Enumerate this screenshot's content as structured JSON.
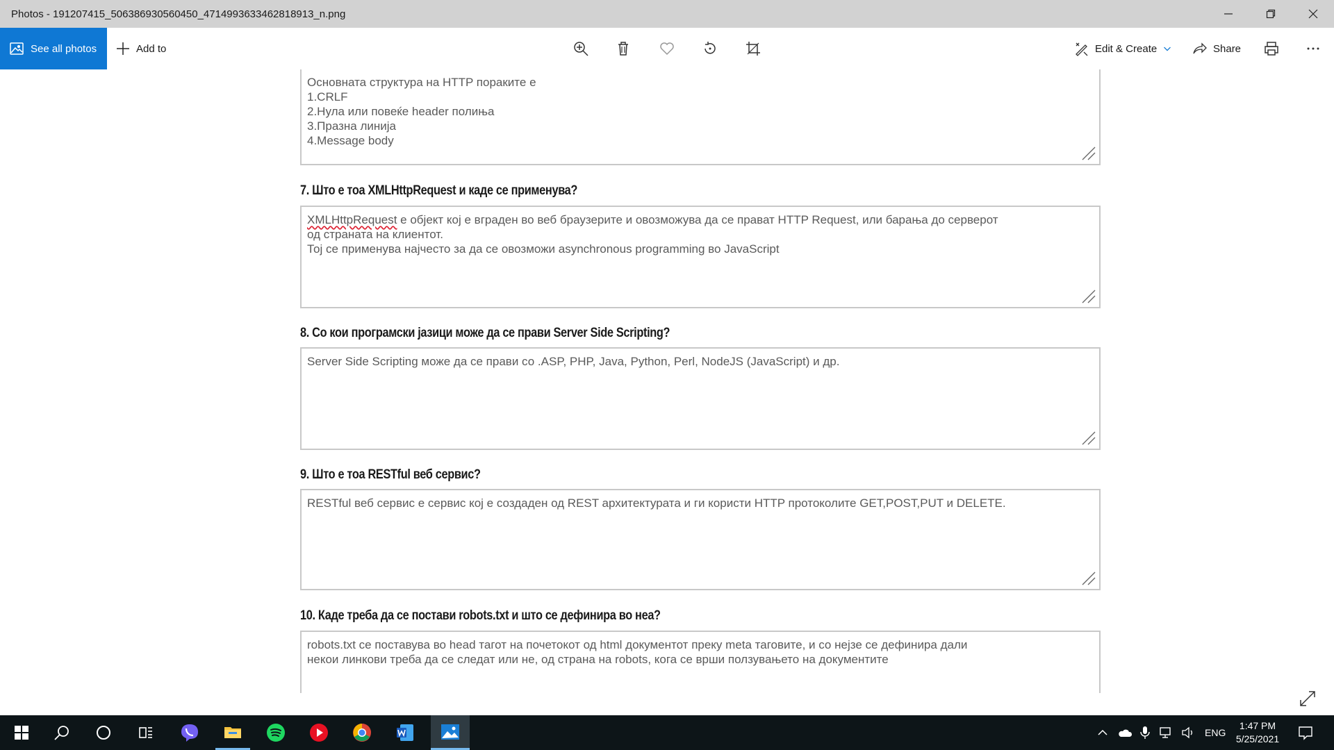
{
  "window": {
    "title": "Photos - 191207415_506386930560450_4714993633462818913_n.png"
  },
  "toolbar": {
    "see_all_label": "See all photos",
    "add_to_label": "Add to",
    "edit_create_label": "Edit & Create",
    "share_label": "Share",
    "icons": [
      "zoom-in-icon",
      "delete-icon",
      "favorite-icon",
      "rotate-icon",
      "crop-icon",
      "print-icon",
      "more-icon"
    ]
  },
  "photo": {
    "box0": {
      "lines": [
        "Основната структура на HTTP пораките е",
        "1.CRLF",
        "2.Нула или повеќе header полиња",
        "3.Празна линија",
        "4.Message body"
      ]
    },
    "q7": {
      "question": "7. Што е тоа XMLHttpRequest и каде се применува?",
      "misspelled": "XMLHttpRequest",
      "line1_rest": " е објект кој е вграден во веб браузерите и овозможува да се прават HTTP Request, или барања до серверот",
      "line2": "од страната на клиентот.",
      "line3": "Тој се применува најчесто за да се овозможи asynchronous programming во JavaScript"
    },
    "q8": {
      "question": "8. Со кои програмски јазици може да се прави Server Side Scripting?",
      "answer": "Server Side Scripting може да се прави со .ASP, PHP, Java, Python, Perl, NodeJS (JavaScript) и др."
    },
    "q9": {
      "question": "9. Што е тоа RESTful веб сервис?",
      "answer": "RESTful веб сервис е сервис кој е создаден од REST архитектурата и ги користи HTTP протоколите GET,POST,PUT и DELETE."
    },
    "q10": {
      "question": "10. Каде треба да се постави robots.txt и што се дефинира во неа?",
      "line1": "robots.txt се поставува во head тагот на почетокот од html документот преку meta таговите, и со нејзе се дефинира дали",
      "line2": "некои линкови треба да се следат или не, од страна на robots, кога се врши ползувањето на документите"
    }
  },
  "taskbar": {
    "apps": [
      "start-icon",
      "search-icon",
      "cortana-icon",
      "task-view-icon",
      "viber-icon",
      "file-explorer-icon",
      "spotify-icon",
      "media-player-icon",
      "chrome-icon",
      "word-icon",
      "photos-icon"
    ],
    "language": "ENG",
    "time": "1:47 PM",
    "date": "5/25/2021"
  },
  "colors": {
    "accent": "#0f78d4",
    "titlebar": "#d2d2d2",
    "taskbar": "#0d1518"
  }
}
